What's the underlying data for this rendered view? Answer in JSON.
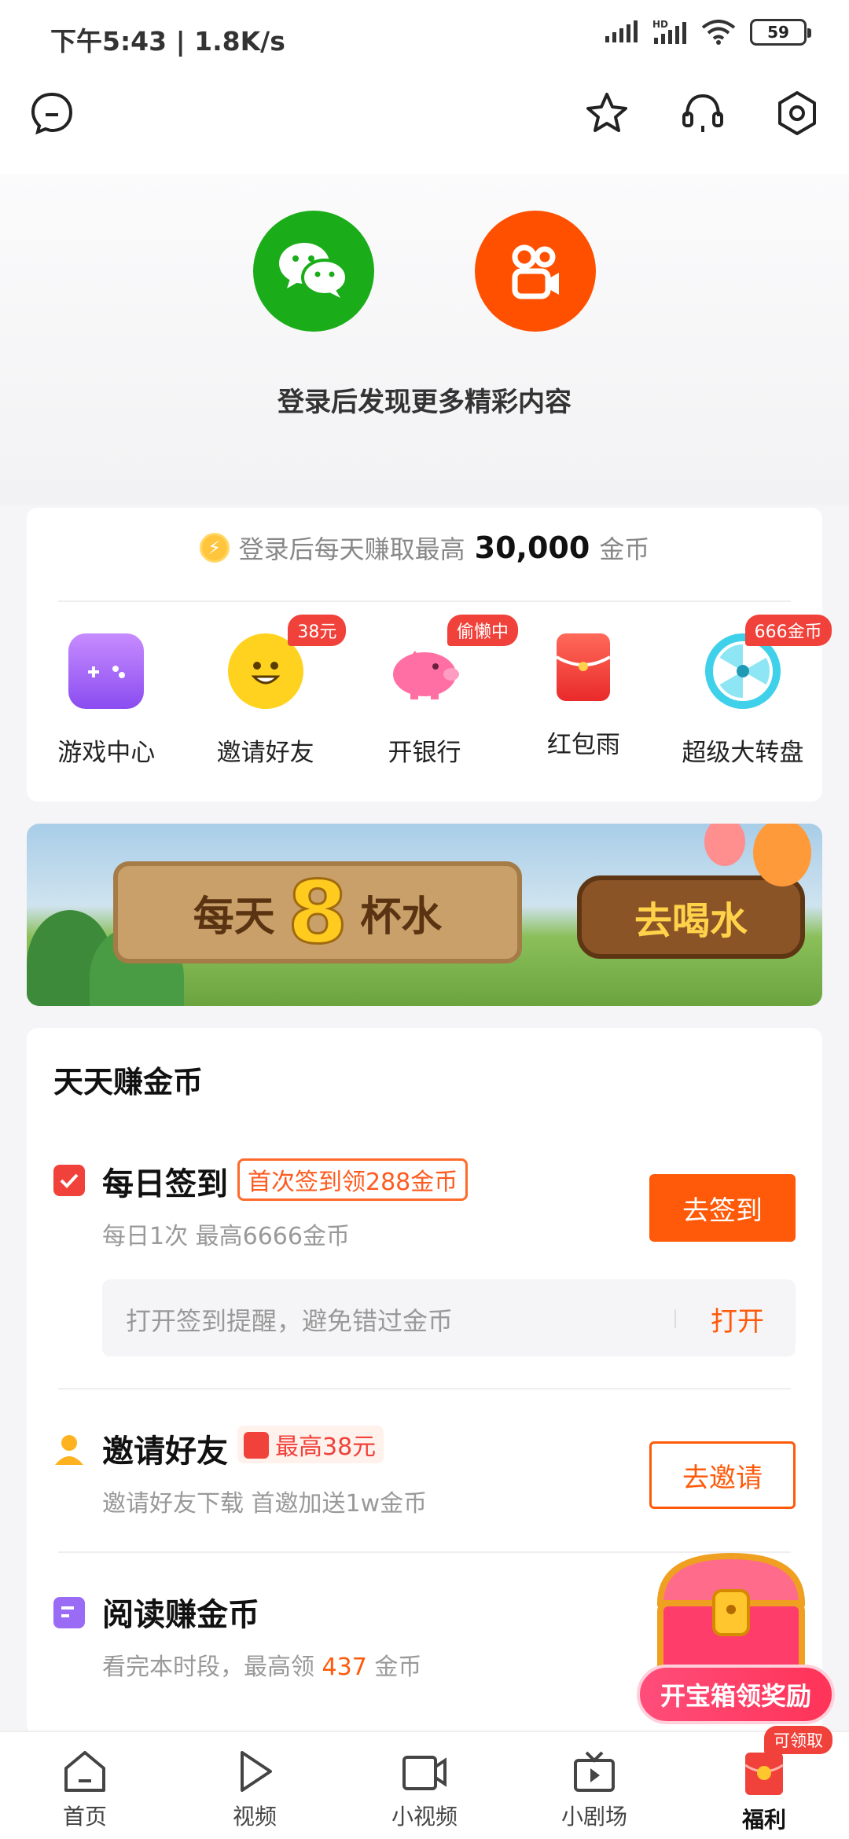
{
  "status": {
    "time": "下午5:43 | 1.8K/s",
    "signal1": "",
    "hd": "HD",
    "battery": "59"
  },
  "topbar": {},
  "login": {
    "hint": "登录后发现更多精彩内容"
  },
  "earn": {
    "prefix": "登录后每天赚取最高",
    "amount": "30,000",
    "suffix": "金币",
    "items": [
      {
        "label": "游戏中心",
        "badge": ""
      },
      {
        "label": "邀请好友",
        "badge": "38元"
      },
      {
        "label": "开银行",
        "badge": "偷懒中"
      },
      {
        "label": "红包雨",
        "badge": ""
      },
      {
        "label": "超级大转盘",
        "badge": "666金币"
      }
    ]
  },
  "banner": {
    "left1": "每天",
    "big": "8",
    "left2": "杯水",
    "right": "去喝水"
  },
  "tasks": {
    "title": "天天赚金币",
    "checkin": {
      "name": "每日签到",
      "tag": "首次签到领288金币",
      "sub": "每日1次  最高6666金币",
      "button": "去签到",
      "remind": "打开签到提醒，避免错过金币",
      "remind_button": "打开"
    },
    "invite": {
      "name": "邀请好友",
      "tag": "最高38元",
      "sub": "邀请好友下载 首邀加送1w金币",
      "button": "去邀请"
    },
    "read": {
      "name": "阅读赚金币",
      "sub_prefix": "看完本时段，最高领",
      "sub_amount": "437",
      "sub_suffix": "金币"
    }
  },
  "treasure": {
    "label": "开宝箱领奖励"
  },
  "bottomnav": [
    {
      "label": "首页"
    },
    {
      "label": "视频"
    },
    {
      "label": "小视频"
    },
    {
      "label": "小剧场"
    },
    {
      "label": "福利",
      "badge": "可领取"
    }
  ],
  "colors": {
    "accent": "#ff5a0a",
    "wechat": "#1aad19",
    "kuaishou": "#ff5000",
    "badge": "#f0413a"
  }
}
